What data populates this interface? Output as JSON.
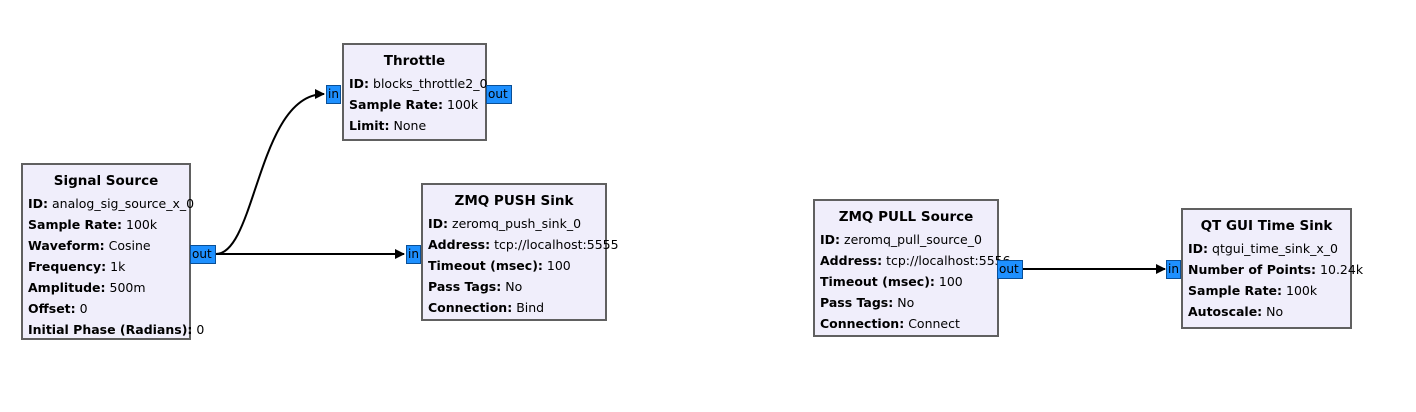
{
  "blocks": {
    "throttle": {
      "title": "Throttle",
      "params": [
        {
          "key": "ID:",
          "value": "blocks_throttle2_0"
        },
        {
          "key": "Sample Rate:",
          "value": "100k"
        },
        {
          "key": "Limit:",
          "value": "None"
        }
      ]
    },
    "signal_source": {
      "title": "Signal Source",
      "params": [
        {
          "key": "ID:",
          "value": "analog_sig_source_x_0"
        },
        {
          "key": "Sample Rate:",
          "value": "100k"
        },
        {
          "key": "Waveform:",
          "value": "Cosine"
        },
        {
          "key": "Frequency:",
          "value": "1k"
        },
        {
          "key": "Amplitude:",
          "value": "500m"
        },
        {
          "key": "Offset:",
          "value": "0"
        },
        {
          "key": "Initial Phase (Radians):",
          "value": "0"
        }
      ]
    },
    "zmq_push_sink": {
      "title": "ZMQ PUSH Sink",
      "params": [
        {
          "key": "ID:",
          "value": "zeromq_push_sink_0"
        },
        {
          "key": "Address:",
          "value": "tcp://localhost:5555"
        },
        {
          "key": "Timeout (msec):",
          "value": "100"
        },
        {
          "key": "Pass Tags:",
          "value": "No"
        },
        {
          "key": "Connection:",
          "value": "Bind"
        }
      ]
    },
    "zmq_pull_source": {
      "title": "ZMQ PULL Source",
      "params": [
        {
          "key": "ID:",
          "value": "zeromq_pull_source_0"
        },
        {
          "key": "Address:",
          "value": "tcp://localhost:5556"
        },
        {
          "key": "Timeout (msec):",
          "value": "100"
        },
        {
          "key": "Pass Tags:",
          "value": "No"
        },
        {
          "key": "Connection:",
          "value": "Connect"
        }
      ]
    },
    "qt_gui_time_sink": {
      "title": "QT GUI Time Sink",
      "params": [
        {
          "key": "ID:",
          "value": "qtgui_time_sink_x_0"
        },
        {
          "key": "Number of Points:",
          "value": "10.24k"
        },
        {
          "key": "Sample Rate:",
          "value": "100k"
        },
        {
          "key": "Autoscale:",
          "value": "No"
        }
      ]
    }
  },
  "ports": {
    "in_label": "in",
    "out_label": "out"
  },
  "colors": {
    "block_fill": "#f0eefb",
    "block_border": "#606060",
    "port_fill": "#1e90ff",
    "connection": "#000000"
  }
}
